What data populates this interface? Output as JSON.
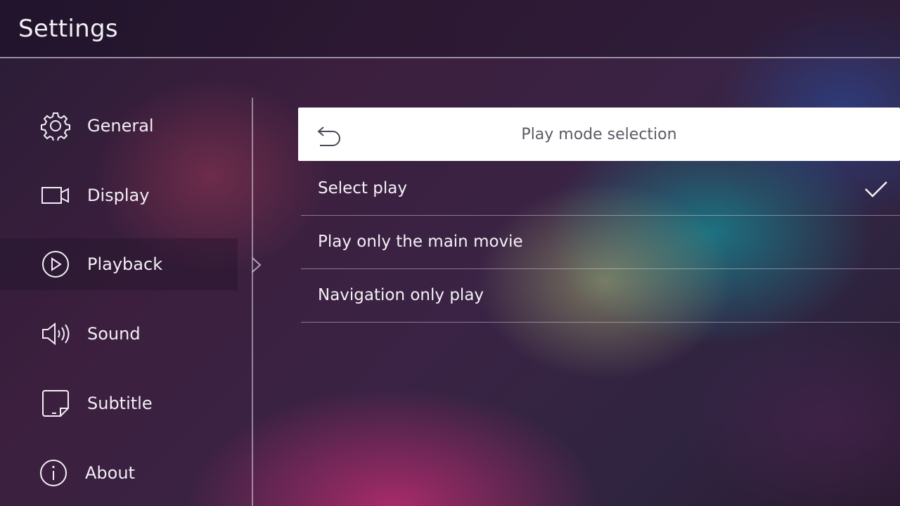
{
  "header": {
    "title": "Settings"
  },
  "sidebar": {
    "active_index": 2,
    "items": [
      {
        "label": "General",
        "icon": "gear-icon"
      },
      {
        "label": "Display",
        "icon": "display-icon"
      },
      {
        "label": "Playback",
        "icon": "play-circle-icon"
      },
      {
        "label": "Sound",
        "icon": "speaker-icon"
      },
      {
        "label": "Subtitle",
        "icon": "subtitle-icon"
      },
      {
        "label": "About",
        "icon": "info-icon"
      }
    ]
  },
  "panel": {
    "title": "Play mode selection",
    "back_icon": "back-arrow-icon",
    "selected_index": 0,
    "options": [
      {
        "label": "Select play",
        "selected": true
      },
      {
        "label": "Play only the main movie",
        "selected": false
      },
      {
        "label": "Navigation only play",
        "selected": false
      }
    ]
  },
  "colors": {
    "panel_header_bg": "#ffffff",
    "panel_title_text": "#5a5a66",
    "text_primary": "#f3eff6",
    "divider": "#dcd2e6"
  }
}
